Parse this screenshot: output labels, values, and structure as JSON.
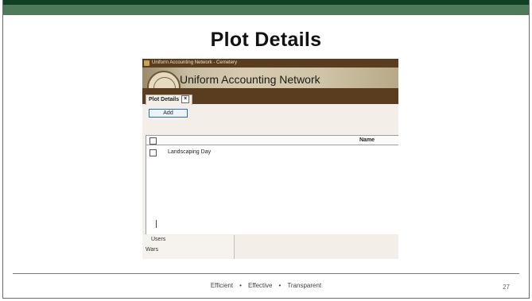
{
  "slide": {
    "title": "Plot Details",
    "footer": {
      "items": [
        "Efficient",
        "Effective",
        "Transparent"
      ],
      "separator": "•"
    },
    "page_number": "27",
    "colors": {
      "top_bar_dark": "#0f4024",
      "top_bar_light": "#4e7a59"
    }
  },
  "app": {
    "window_title": "Uniform Accounting Network - Cemetery",
    "banner_title": "Uniform Accounting Network",
    "tabs": [
      {
        "label": "Plot Details",
        "close_glyph": "×"
      }
    ],
    "toolbar": {
      "add_label": "Add"
    },
    "grid": {
      "columns": [
        "",
        "Name"
      ],
      "rows": [
        {
          "checked": false,
          "name": "Landscaping Day"
        }
      ]
    },
    "bottom_list": [
      "Users",
      "Wars"
    ],
    "colors": {
      "chrome_brown": "#5a3d1f",
      "button_border": "#2c6db5"
    }
  }
}
